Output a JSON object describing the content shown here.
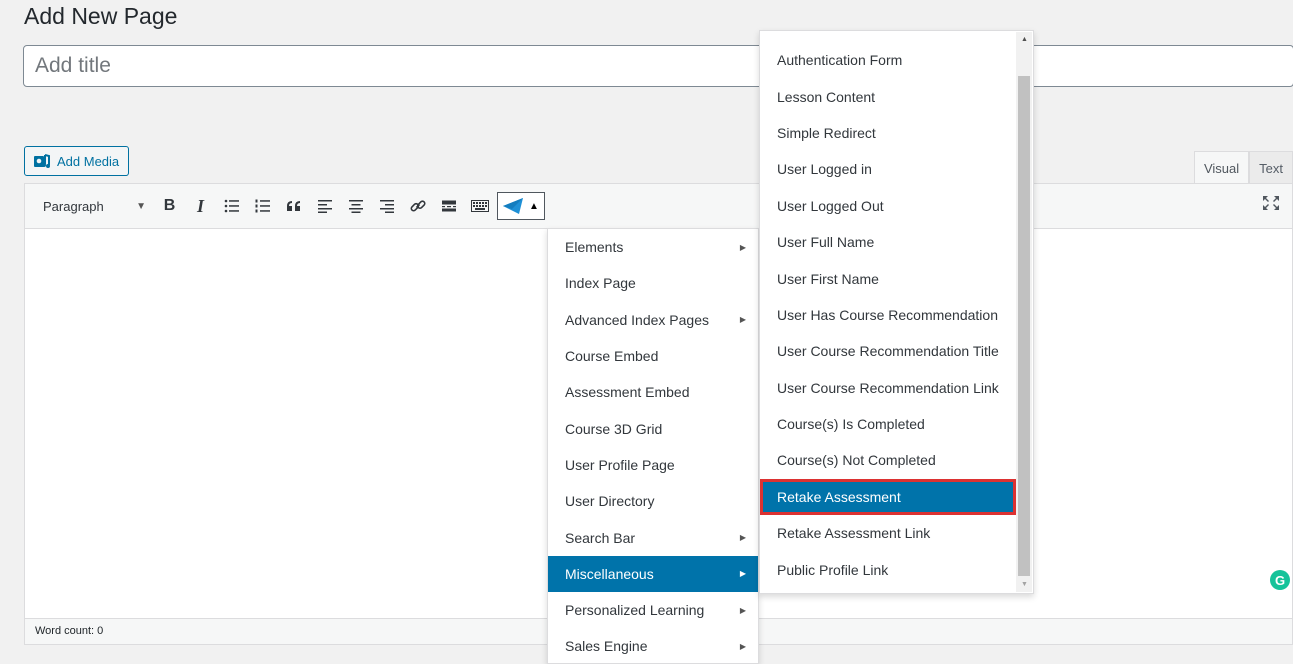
{
  "page": {
    "heading": "Add New Page"
  },
  "title_field": {
    "placeholder": "Add title",
    "value": ""
  },
  "media": {
    "add_media_label": "Add Media"
  },
  "editor": {
    "tabs": [
      {
        "label": "Visual",
        "active": true
      },
      {
        "label": "Text",
        "active": false
      }
    ],
    "format_select": "Paragraph",
    "word_count": "Word count: 0"
  },
  "grammarly": {
    "letter": "G"
  },
  "dropdown": {
    "items": [
      {
        "label": "Elements",
        "submenu": true
      },
      {
        "label": "Index Page",
        "submenu": false
      },
      {
        "label": "Advanced Index Pages",
        "submenu": true
      },
      {
        "label": "Course Embed",
        "submenu": false
      },
      {
        "label": "Assessment Embed",
        "submenu": false
      },
      {
        "label": "Course 3D Grid",
        "submenu": false
      },
      {
        "label": "User Profile Page",
        "submenu": false
      },
      {
        "label": "User Directory",
        "submenu": false
      },
      {
        "label": "Search Bar",
        "submenu": true
      },
      {
        "label": "Miscellaneous",
        "submenu": true,
        "active": true
      },
      {
        "label": "Personalized Learning",
        "submenu": true
      },
      {
        "label": "Sales Engine",
        "submenu": true
      }
    ]
  },
  "submenu": {
    "items": [
      {
        "label": "Authentication Form"
      },
      {
        "label": "Lesson Content"
      },
      {
        "label": "Simple Redirect"
      },
      {
        "label": "User Logged in"
      },
      {
        "label": "User Logged Out"
      },
      {
        "label": "User Full Name"
      },
      {
        "label": "User First Name"
      },
      {
        "label": "User Has Course Recommendation"
      },
      {
        "label": "User Course Recommendation Title"
      },
      {
        "label": "User Course Recommendation Link"
      },
      {
        "label": "Course(s) Is Completed"
      },
      {
        "label": "Course(s) Not Completed"
      },
      {
        "label": "Retake Assessment",
        "active": true
      },
      {
        "label": "Retake Assessment Link"
      },
      {
        "label": "Public Profile Link"
      }
    ]
  },
  "colors": {
    "accent": "#0073aa",
    "highlight_outline": "#dc3232",
    "plugin_icon": "#1e90d6"
  }
}
